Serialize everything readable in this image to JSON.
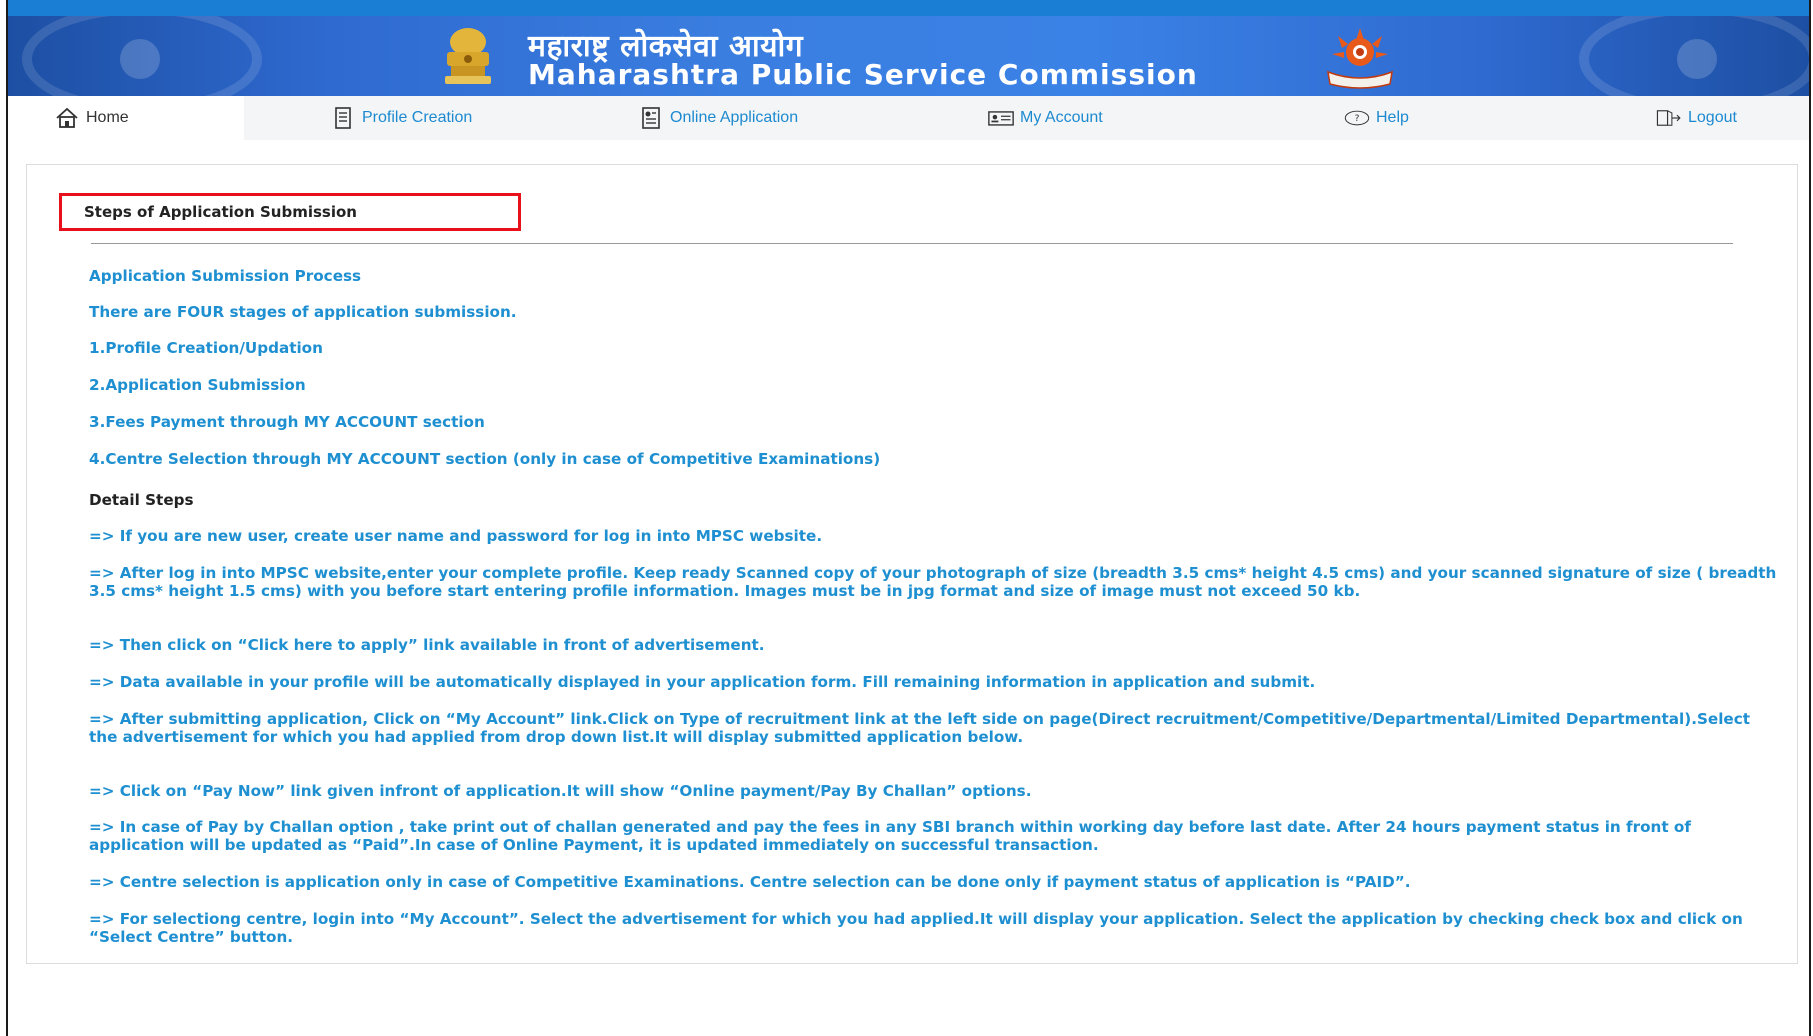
{
  "header": {
    "title_hindi": "महाराष्ट्र लोकसेवा आयोग",
    "title_english": "Maharashtra Public Service Commission"
  },
  "nav": {
    "home": "Home",
    "profile_creation": "Profile Creation",
    "online_application": "Online Application",
    "my_account": "My Account",
    "help": "Help",
    "logout": "Logout"
  },
  "content": {
    "heading": "Steps of Application Submission",
    "process_title": "Application Submission Process",
    "stages_intro": "There are FOUR stages of application submission.",
    "stage_1": "1.Profile Creation/Updation",
    "stage_2": "2.Application Submission",
    "stage_3": "3.Fees Payment through MY ACCOUNT section",
    "stage_4": "4.Centre Selection through MY ACCOUNT section (only in case of Competitive Examinations)",
    "detail_title": "Detail Steps",
    "step_1": "=> If you are new user, create user name and password for log in into MPSC website.",
    "step_2": "=> After log in into MPSC website,enter your complete profile. Keep ready Scanned copy of your photograph of size (breadth 3.5 cms* height 4.5 cms) and your scanned signature of size ( breadth 3.5 cms* height 1.5 cms) with you before start entering profile information. Images must be in jpg format and size of image must not exceed 50 kb.",
    "step_3": "=> Then click on “Click here to apply” link available in front of advertisement.",
    "step_4": "=> Data available in your profile will be automatically displayed in your application form. Fill remaining information in application and submit.",
    "step_5": "=> After submitting application, Click on “My Account” link.Click on Type of recruitment link at the left side on page(Direct recruitment/Competitive/Departmental/Limited Departmental).Select the advertisement for which you had applied from drop down list.It will display submitted application below.",
    "step_6": "=> Click on “Pay Now” link given infront of application.It will show “Online payment/Pay By Challan” options.",
    "step_7": "=> In case of Pay by Challan option , take print out of challan generated and pay the fees in any SBI branch within working day before last date. After 24 hours payment status in front of application will be updated as “Paid”.In case of Online Payment, it is updated immediately on successful transaction.",
    "step_8": "=> Centre selection is application only in case of Competitive Examinations. Centre selection can be done only if payment status of application is “PAID”.",
    "step_9": "=> For selectiong centre, login into “My Account”. Select the advertisement for which you had applied.It will display your application. Select the application by checking check box and click on “Select Centre” button."
  },
  "colors": {
    "banner_blue": "#2f6ad0",
    "link_blue": "#1e8fd0",
    "highlight_red": "#e8101b"
  }
}
